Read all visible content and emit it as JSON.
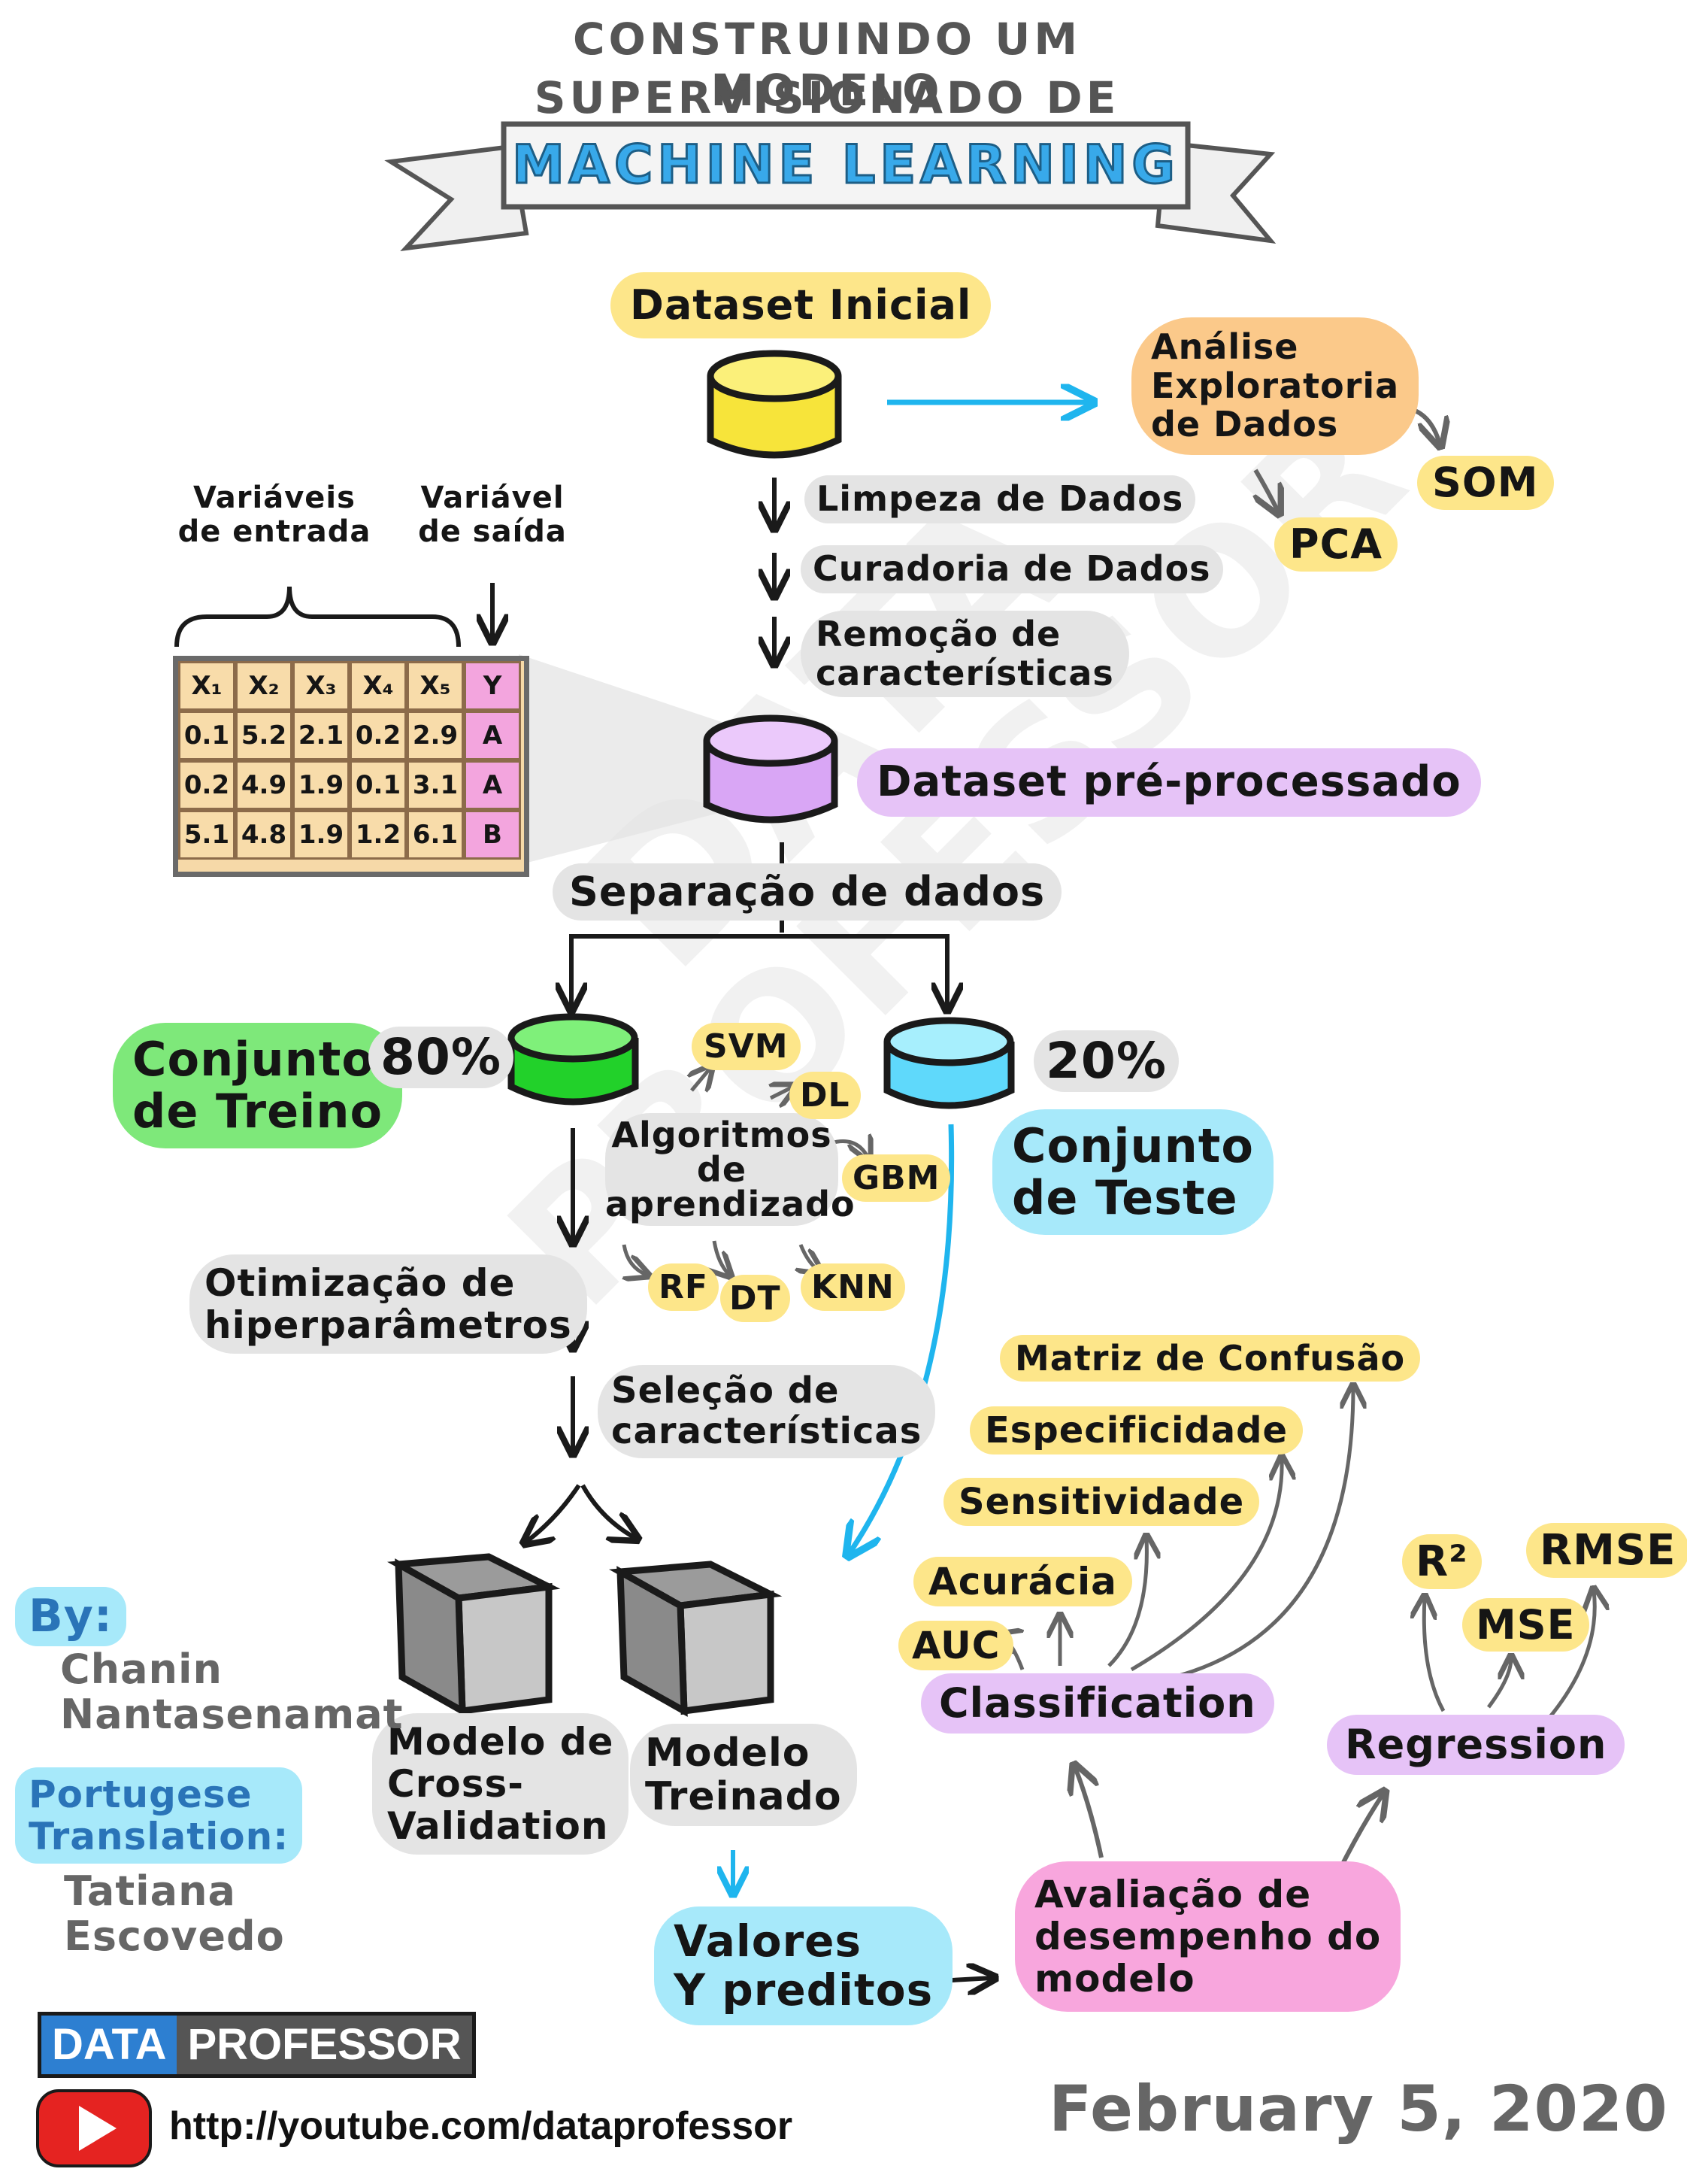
{
  "title": {
    "line1": "CONSTRUINDO UM MODELO",
    "line2": "SUPERVISIONADO DE",
    "banner": "MACHINE LEARNING"
  },
  "watermark": {
    "line1": "DATA",
    "line2": "PROFESSOR"
  },
  "nodes": {
    "dataset_inicial": "Dataset Inicial",
    "analise": "Análise\nExploratoria\nde Dados",
    "som": "SOM",
    "pca": "PCA",
    "limpeza": "Limpeza de Dados",
    "curadoria": "Curadoria de Dados",
    "remocao": "Remoção de\ncaracterísticas",
    "dataset_pre": "Dataset pré-processado",
    "separacao": "Separação de dados",
    "treino": "Conjunto\nde Treino",
    "treino_pct": "80%",
    "teste": "Conjunto\nde Teste",
    "teste_pct": "20%",
    "algoritmos": "Algoritmos\nde\naprendizado",
    "otimizacao": "Otimização de\nhiperparâmetros",
    "selecao": "Seleção de\ncaracterísticas",
    "modelo_cv": "Modelo de\nCross-\nValidation",
    "modelo_treinado": "Modelo\nTreinado",
    "valores": "Valores\nY preditos",
    "avaliacao": "Avaliação de\ndesempenho do\nmodelo",
    "classification": "Classification",
    "regression": "Regression"
  },
  "algorithms": [
    "SVM",
    "DL",
    "GBM",
    "RF",
    "DT",
    "KNN"
  ],
  "classification_metrics": [
    "Matriz de Confusão",
    "Especificidade",
    "Sensitividade",
    "Acurácia",
    "AUC"
  ],
  "regression_metrics": [
    "R²",
    "MSE",
    "RMSE"
  ],
  "table": {
    "label_inputs": "Variáveis\nde entrada",
    "label_output": "Variável\nde saída",
    "headers": [
      "X₁",
      "X₂",
      "X₃",
      "X₄",
      "X₅",
      "Y"
    ],
    "rows": [
      [
        "0.1",
        "5.2",
        "2.1",
        "0.2",
        "2.9",
        "A"
      ],
      [
        "0.2",
        "4.9",
        "1.9",
        "0.1",
        "3.1",
        "A"
      ],
      [
        "5.1",
        "4.8",
        "1.9",
        "1.2",
        "6.1",
        "B"
      ]
    ]
  },
  "credits": {
    "by_label": "By:",
    "author": "Chanin\nNantasenamat",
    "translation_label": "Portugese\nTranslation:",
    "translator": "Tatiana\nEscovedo"
  },
  "brand": {
    "data": "DATA",
    "professor": "PROFESSOR"
  },
  "url": "http://youtube.com/dataprofessor",
  "date": "February 5, 2020",
  "colors": {
    "yellow": "#fde68a",
    "yellow_db": "#f7e43a",
    "orange": "#fbc98a",
    "purple": "#e6c3f7",
    "purple_db": "#d9a6f5",
    "green": "#7ee87a",
    "green_db": "#22d12a",
    "cyan": "#a7e9fa",
    "cyan_db": "#5fd9fb",
    "pink": "#f8a6dd",
    "gray": "#e4e4e4",
    "blue_arrow": "#1fb5ee",
    "banner_blue": "#38a9ea"
  }
}
